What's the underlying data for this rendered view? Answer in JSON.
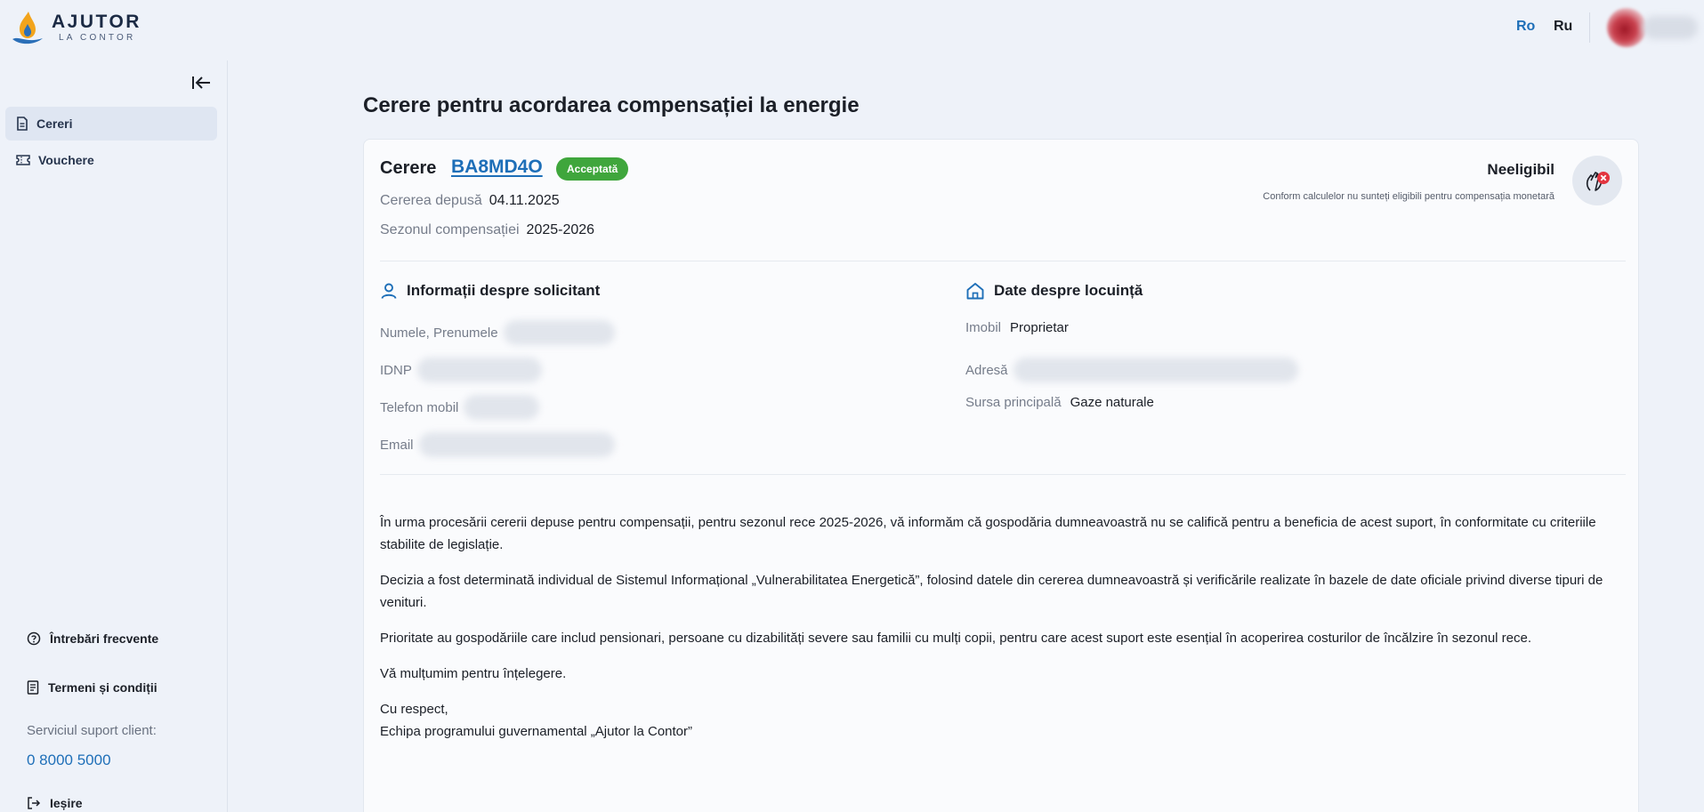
{
  "header": {
    "logo_title": "AJUTOR",
    "logo_subtitle": "LA CONTOR",
    "lang_ro": "Ro",
    "lang_ru": "Ru"
  },
  "sidebar": {
    "items": [
      {
        "label": "Cereri",
        "icon": "document-icon",
        "active": true
      },
      {
        "label": "Vouchere",
        "icon": "ticket-icon",
        "active": false
      }
    ],
    "faq_label": "Întrebări frecvente",
    "terms_label": "Termeni și condiții",
    "support_label": "Serviciul suport client:",
    "support_phone": "0 8000 5000",
    "exit_label": "Ieșire"
  },
  "page": {
    "title": "Cerere pentru acordarea compensației la energie"
  },
  "request": {
    "title": "Cerere",
    "code": "BA8MD4O",
    "status": "Acceptată",
    "submitted_label": "Cererea depusă",
    "submitted_value": "04.11.2025",
    "season_label": "Sezonul compensației",
    "season_value": "2025-2026",
    "eligibility_title": "Neeligibil",
    "eligibility_note": "Conform calculelor nu sunteți eligibili pentru compensația monetară"
  },
  "applicant": {
    "heading": "Informații despre solicitant",
    "name_label": "Numele, Prenumele",
    "idnp_label": "IDNP",
    "phone_label": "Telefon mobil",
    "email_label": "Email"
  },
  "housing": {
    "heading": "Date despre locuință",
    "property_label": "Imobil",
    "property_value": "Proprietar",
    "address_label": "Adresă",
    "source_label": "Sursa principală",
    "source_value": "Gaze naturale"
  },
  "message": {
    "p1": "În urma procesării cererii depuse pentru compensații, pentru sezonul rece 2025-2026, vă informăm că gospodăria dumneavoastră nu se califică pentru a beneficia de acest suport, în conformitate cu criteriile stabilite de legislație.",
    "p2": "Decizia a fost determinată individual de Sistemul Informațional „Vulnerabilitatea Energetică”, folosind datele din cererea dumneavoastră și verificările realizate în bazele de date oficiale privind diverse tipuri de venituri.",
    "p3": "Prioritate au gospodăriile care includ pensionari, persoane cu dizabilități severe sau familii cu mulți copii, pentru care acest suport este esențial în acoperirea costurilor de încălzire în sezonul rece.",
    "p4": "Vă mulțumim pentru înțelegere.",
    "closing": "Cu respect,",
    "signature": "Echipa programului guvernamental „Ajutor la Contor”"
  },
  "colors": {
    "accent": "#1e6fb8",
    "success_badge": "#3fa63c",
    "error": "#e3343f",
    "background": "#eef2f9"
  }
}
